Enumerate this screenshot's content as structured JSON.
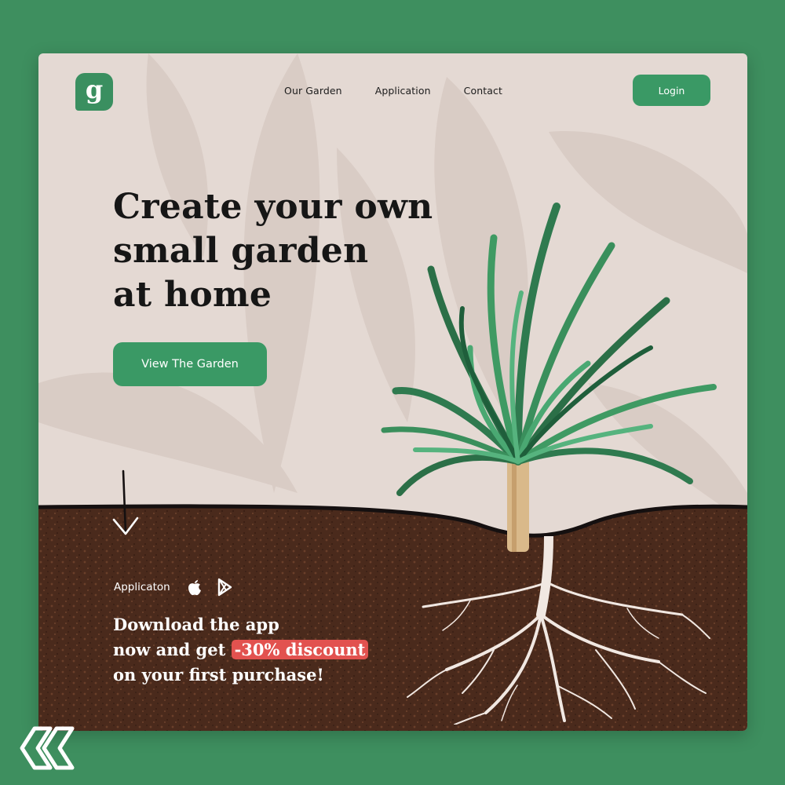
{
  "nav": {
    "logo_letter": "g",
    "links": [
      "Our Garden",
      "Application",
      "Contact"
    ],
    "login_label": "Login"
  },
  "hero": {
    "title_lines": [
      "Create your own",
      "small garden",
      "at home"
    ],
    "cta_label": "View The Garden"
  },
  "app": {
    "label": "Applicaton",
    "icons": [
      "apple-icon",
      "google-play-icon"
    ]
  },
  "promo": {
    "line1": "Download the app",
    "line2_prefix": "now and get ",
    "discount": "-30% discount",
    "line3": "on your first purchase!"
  },
  "colors": {
    "page_background": "#3e8f5f",
    "card_background": "#e4d9d3",
    "accent_green": "#3a9965",
    "discount_red": "#e2524f",
    "soil": "#4a2a1c"
  },
  "decor": {
    "arrow_icon": "arrow-down-icon",
    "brand_mark": "brand-logo-icon"
  }
}
